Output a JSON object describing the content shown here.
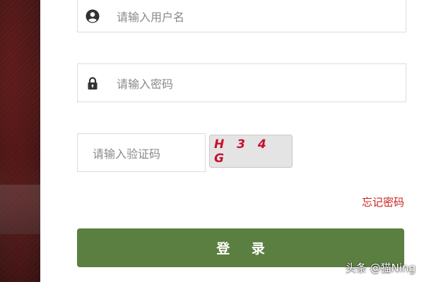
{
  "login_form": {
    "username": {
      "placeholder": "请输入用户名",
      "icon": "user-circle-icon"
    },
    "password": {
      "placeholder": "请输入密码",
      "icon": "lock-icon"
    },
    "captcha": {
      "placeholder": "请输入验证码",
      "code": "H 3 4 G"
    },
    "forgot_password": "忘记密码",
    "submit_label": "登 录"
  },
  "watermark": "头条 @猫Ning",
  "colors": {
    "primary_button": "#5b7f41",
    "link": "#cc1f1f",
    "captcha_text": "#c8102e",
    "border": "#dcdcdc",
    "placeholder_text": "#8a8a8a"
  }
}
